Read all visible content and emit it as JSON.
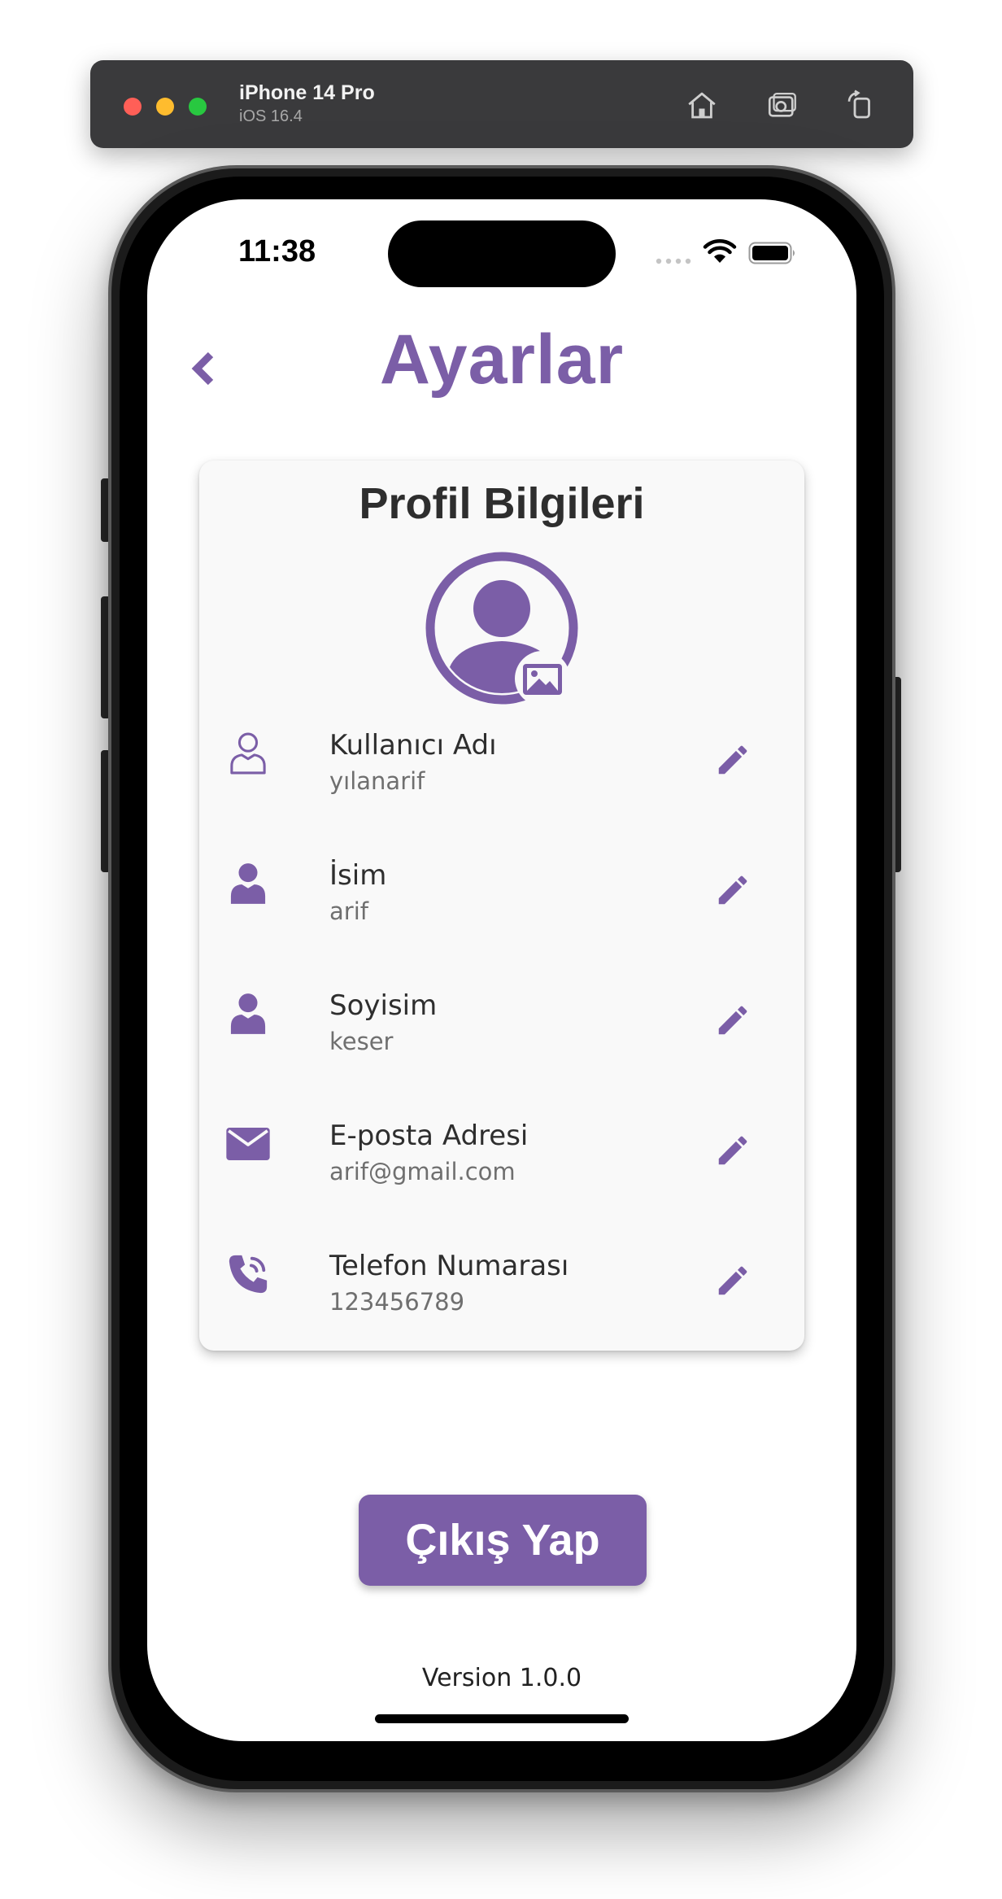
{
  "simulator": {
    "device_name": "iPhone 14 Pro",
    "os_version": "iOS 16.4",
    "controls": [
      "home-icon",
      "screenshot-icon",
      "rotate-icon"
    ]
  },
  "status_bar": {
    "time": "11:38"
  },
  "header": {
    "title": "Ayarlar",
    "back_icon": "chevron-left-icon"
  },
  "profile_card": {
    "title": "Profil Bilgileri",
    "avatar_icon": "account-circle-photo-icon",
    "fields": [
      {
        "label": "Kullanıcı Adı",
        "value": "yılanarif",
        "icon": "user-outline-icon"
      },
      {
        "label": "İsim",
        "value": "arif",
        "icon": "user-filled-icon"
      },
      {
        "label": "Soyisim",
        "value": "keser",
        "icon": "user-filled-icon"
      },
      {
        "label": "E-posta Adresi",
        "value": "arif@gmail.com",
        "icon": "envelope-icon"
      },
      {
        "label": "Telefon Numarası",
        "value": "123456789",
        "icon": "phone-ringing-icon"
      }
    ],
    "edit_icon": "pencil-icon"
  },
  "logout_button": {
    "label": "Çıkış Yap"
  },
  "footer": {
    "version": "Version 1.0.0"
  },
  "colors": {
    "accent": "#7b5ea7",
    "text_dark": "#2e2e2e",
    "text_muted": "#6f6f6f",
    "card_bg": "#f9f9f9"
  }
}
